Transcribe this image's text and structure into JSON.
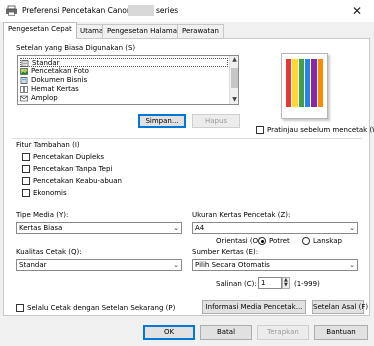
{
  "window": {
    "title": "Preferensi Pencetakan Canon",
    "title_suffix": "series",
    "close_glyph": "✕"
  },
  "tabs": [
    {
      "label": "Pengesetan Cepat",
      "active": true
    },
    {
      "label": "Utama",
      "active": false
    },
    {
      "label": "Pengesetan Halaman",
      "active": false
    },
    {
      "label": "Perawatan",
      "active": false
    }
  ],
  "common_settings": {
    "label": "Setelan yang Biasa Digunakan (S)",
    "items": [
      {
        "label": "Standar",
        "icon": "document-icon",
        "selected": true
      },
      {
        "label": "Pencetakan Foto",
        "icon": "photo-icon",
        "selected": false
      },
      {
        "label": "Dokumen Bisnis",
        "icon": "document-icon",
        "selected": false
      },
      {
        "label": "Hemat Kertas",
        "icon": "paper-saving-icon",
        "selected": false
      },
      {
        "label": "Amplop",
        "icon": "envelope-icon",
        "selected": false
      }
    ],
    "save_button": "Simpan...",
    "delete_button": "Hapus"
  },
  "preview": {
    "checkbox_label": "Pratinjau sebelum mencetak (W)",
    "checked": false,
    "colors": [
      "#e53935",
      "#fdd835",
      "#43a047",
      "#1e88e5",
      "#8e24aa",
      "#fb8c00"
    ]
  },
  "additional_features": {
    "label": "Fitur Tambahan (I)",
    "items": [
      {
        "label": "Pencetakan Dupleks",
        "checked": false
      },
      {
        "label": "Pencetakan Tanpa Tepi",
        "checked": false
      },
      {
        "label": "Pencetakan Keabu-abuan",
        "checked": false
      },
      {
        "label": "Ekonomis",
        "checked": false
      }
    ]
  },
  "media_type": {
    "label": "Tipe Media (Y):",
    "value": "Kertas Biasa"
  },
  "print_quality": {
    "label": "Kualitas Cetak (Q):",
    "value": "Standar"
  },
  "paper_size": {
    "label": "Ukuran Kertas Pencetak (Z):",
    "value": "A4"
  },
  "orientation": {
    "label": "Orientasi (O):",
    "options": [
      {
        "label": "Potret",
        "selected": true
      },
      {
        "label": "Lanskap",
        "selected": false
      }
    ]
  },
  "paper_source": {
    "label": "Sumber Kertas (E):",
    "value": "Pilih Secara Otomatis"
  },
  "copies": {
    "label": "Salinan (C):",
    "value": "1",
    "range": "(1-999)"
  },
  "always_print": {
    "label": "Selalu Cetak dengan Setelan Sekarang (P)",
    "checked": false
  },
  "buttons": {
    "media_info": "Informasi Media Pencetak...",
    "defaults": "Setelan Asal (F)",
    "ok": "OK",
    "cancel": "Batal",
    "apply": "Terapkan",
    "help": "Bantuan"
  }
}
